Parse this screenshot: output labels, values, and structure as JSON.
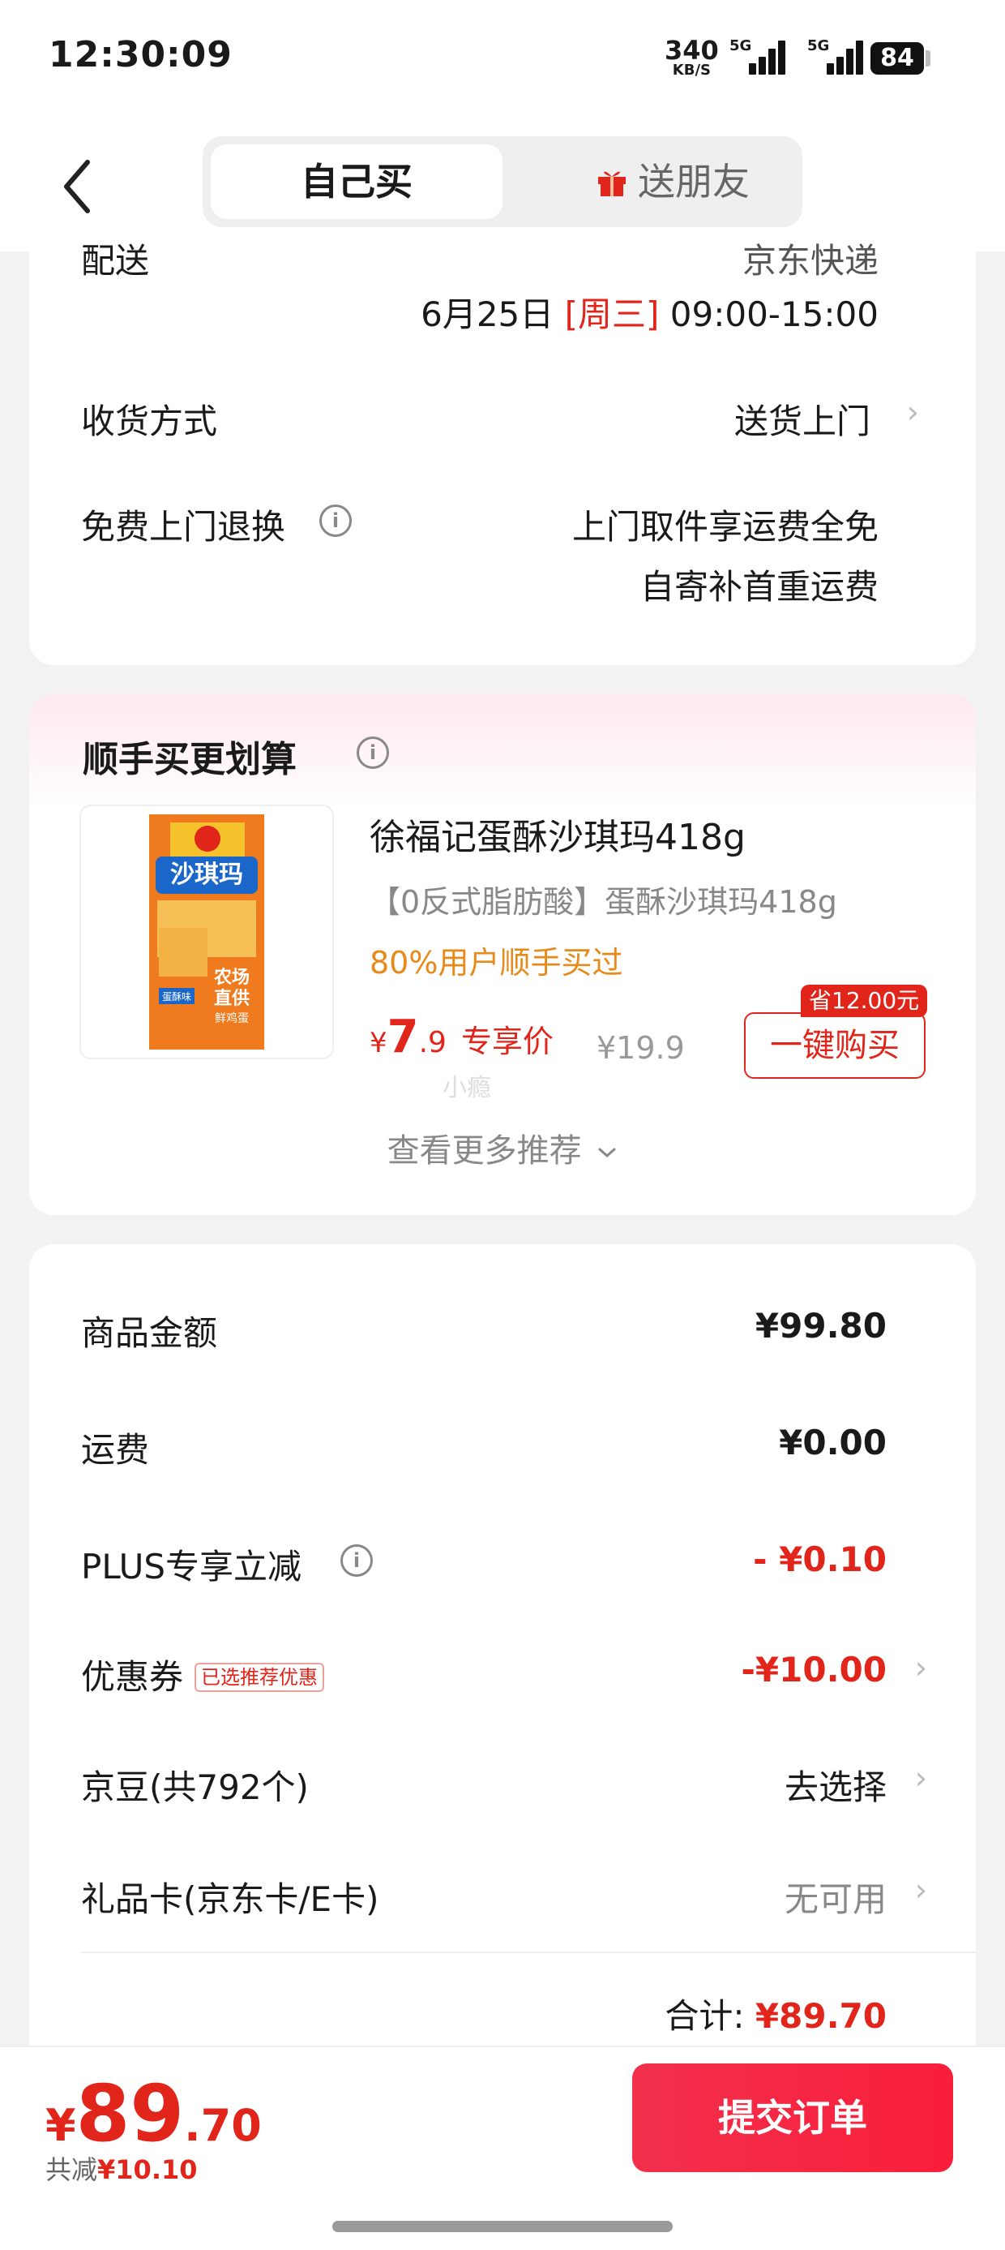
{
  "status_bar": {
    "time": "12:30:09",
    "net_speed": "340",
    "net_speed_unit": "KB/S",
    "signal1_label": "5G",
    "signal2_label": "5G",
    "battery": "84"
  },
  "nav": {
    "tab_self": "自己买",
    "tab_gift": "送朋友"
  },
  "delivery": {
    "label_partial": "配送",
    "carrier_partial": "京东快递",
    "date": "6月25日",
    "weekday": "[周三]",
    "time_window": "09:00-15:00",
    "receive_label": "收货方式",
    "receive_value": "送货上门",
    "return_label": "免费上门退换",
    "return_line1": "上门取件享运费全免",
    "return_line2": "自寄补首重运费"
  },
  "recommend": {
    "title": "顺手买更划算",
    "product_name": "徐福记蛋酥沙琪玛418g",
    "product_sub": "【0反式脂肪酸】蛋酥沙琪玛418g",
    "bought_text": "80%用户顺手买过",
    "price_yen": "¥",
    "price_int": "7",
    "price_dec": ".9",
    "price_tag": "专享价",
    "orig_price": "¥19.9",
    "save_badge": "省12.00元",
    "buy_button": "一键购买",
    "watermark": "小瘾",
    "more_text": "查看更多推荐",
    "thumb_title": "沙琪玛",
    "thumb_text1": "农场",
    "thumb_text2": "直供",
    "thumb_text3": "鲜鸡蛋",
    "thumb_badge": "蛋酥味"
  },
  "summary": {
    "goods_label": "商品金额",
    "goods_value": "¥99.80",
    "shipping_label": "运费",
    "shipping_value": "¥0.00",
    "plus_label": "PLUS专享立减",
    "plus_value": "- ¥0.10",
    "coupon_label": "优惠券",
    "coupon_tag": "已选推荐优惠",
    "coupon_value": "-¥10.00",
    "jingdou_label": "京豆(共792个)",
    "jingdou_value": "去选择",
    "giftcard_label": "礼品卡(京东卡/E卡)",
    "giftcard_value": "无可用",
    "total_label": "合计:",
    "total_value": "¥89.70"
  },
  "bottom": {
    "yen": "¥",
    "total_int": "89",
    "total_dec": ".70",
    "saved_label": "共减",
    "saved_value": "¥10.10",
    "submit": "提交订单"
  },
  "colors": {
    "accent_red": "#e1251b",
    "orange": "#e68a1a",
    "submit_gradient": "#f91e3a"
  }
}
